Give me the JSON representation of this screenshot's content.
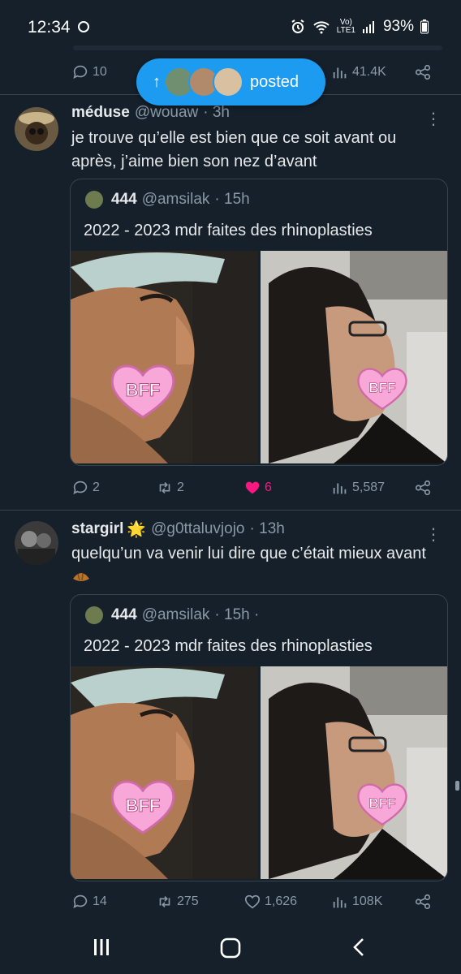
{
  "status": {
    "time": "12:34",
    "volte": "Vo)",
    "lte": "LTE1",
    "battery": "93%"
  },
  "prev_tweet_actions": {
    "replies": "10",
    "views": "41.4K"
  },
  "posted_pill": {
    "label": "posted"
  },
  "tweets": [
    {
      "name": "méduse",
      "handle": "@wouaw",
      "time": "· 3h",
      "text": "je trouve qu’elle est bien que ce soit avant ou après, j’aime bien son nez d’avant",
      "quote": {
        "name": "444",
        "handle": "@amsilak",
        "time": "· 15h",
        "text": "2022 - 2023 mdr faites des rhinoplasties",
        "sticker": "BFF"
      },
      "replies": "2",
      "retweets": "2",
      "likes": "6",
      "views": "5,587"
    },
    {
      "name": "stargirl",
      "emoji": "🌟",
      "handle": "@g0ttaluvjojo",
      "time": "· 13h",
      "text": "quelqu’un va venir lui dire que c’était mieux avant",
      "quote": {
        "name": "444",
        "handle": "@amsilak",
        "time": "· 15h ·",
        "text": "2022 - 2023 mdr faites des rhinoplasties",
        "sticker": "BFF"
      },
      "replies": "14",
      "retweets": "275",
      "likes": "1,626",
      "views": "108K"
    }
  ],
  "colors": {
    "background": "#15202b",
    "accent": "#1d9bf0",
    "like_active": "#f91880",
    "muted": "#8b98a5",
    "sticker": "#f7a8d8"
  },
  "icons": {
    "reply": "reply-icon",
    "retweet": "retweet-icon",
    "like": "heart-icon",
    "views": "views-icon",
    "share": "share-icon",
    "more": "more-icon",
    "nav_recents": "recents-icon",
    "nav_home": "home-icon",
    "nav_back": "back-icon"
  }
}
